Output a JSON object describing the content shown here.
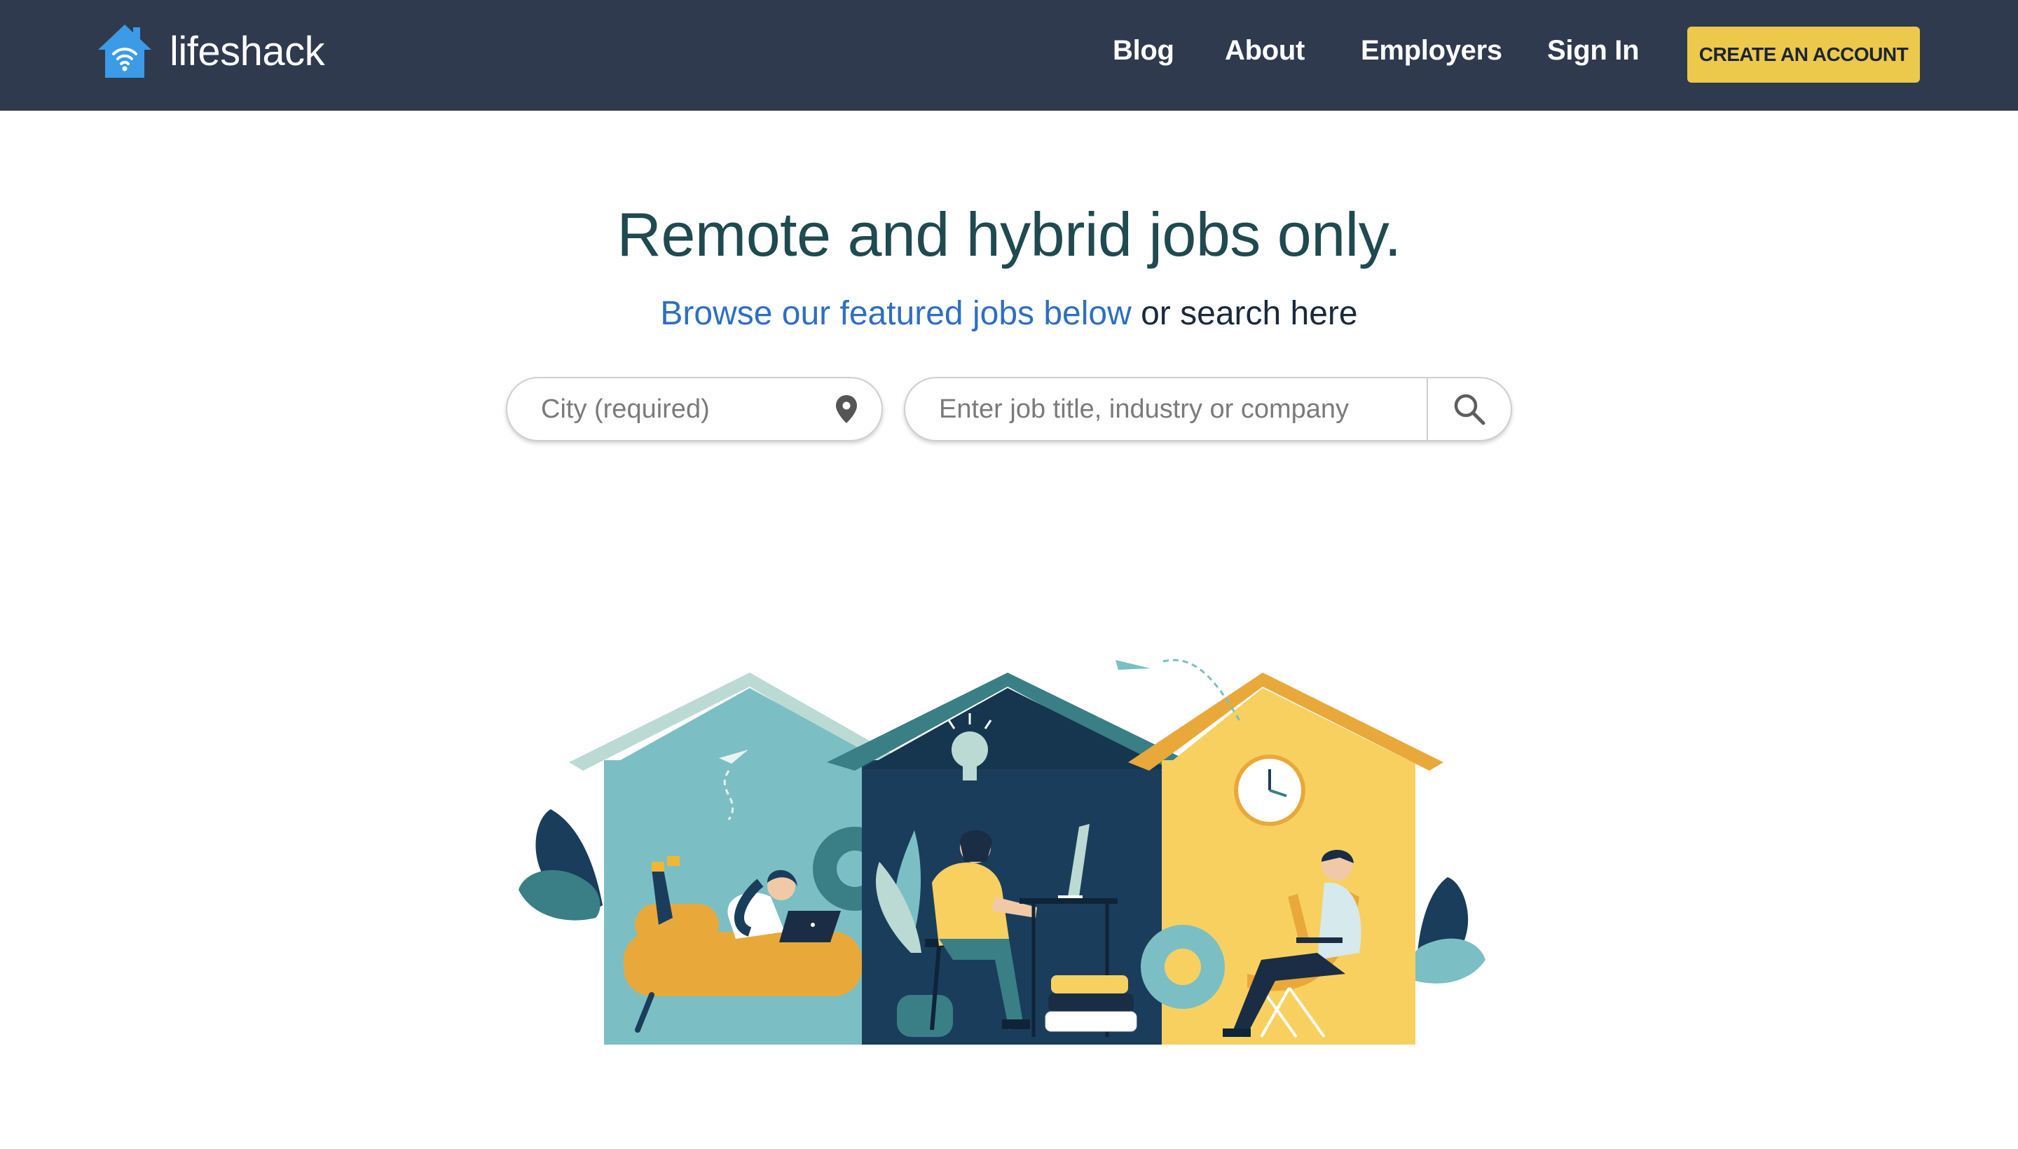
{
  "nav": {
    "logo_text": "lifeshack",
    "links": [
      "Blog",
      "About",
      "Employers",
      "Sign In"
    ],
    "cta_label": "CREATE AN ACCOUNT"
  },
  "hero": {
    "headline": "Remote and hybrid jobs only.",
    "subline_link": "Browse our featured jobs below",
    "subline_rest": " or search here"
  },
  "search": {
    "city_placeholder": "City (required)",
    "job_placeholder": "Enter job title, industry or company",
    "city_icon": "location-pin-icon",
    "submit_icon": "magnifier-icon"
  },
  "colors": {
    "nav_bg": "#2f3a4e",
    "cta_bg": "#ecc94b",
    "headline": "#1f4a4f",
    "link": "#2e6fc0",
    "house_teal": "#7bbfc4",
    "house_navy": "#1a3d5c",
    "house_yellow": "#f8d060"
  }
}
